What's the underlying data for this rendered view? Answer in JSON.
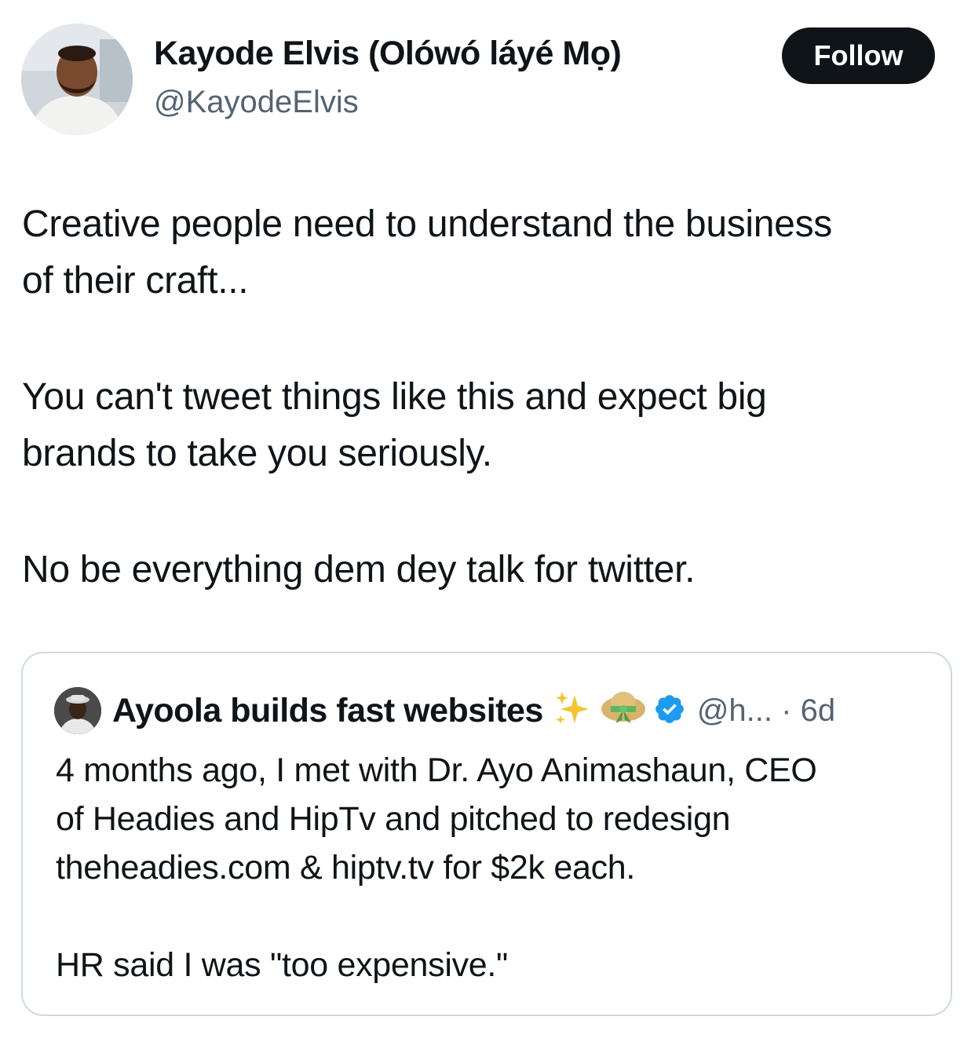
{
  "tweet": {
    "author": {
      "name": "Kayode Elvis (Olówó láyé Mọ)",
      "handle": "@KayodeElvis"
    },
    "follow_label": "Follow",
    "text": {
      "p1_line1": "Creative people need to understand the business",
      "p1_line2": "of their craft...",
      "p2_line1": "You can't tweet things like this and expect big",
      "p2_line2": "brands to take you seriously.",
      "p3_line1": "No be everything dem dey talk for twitter."
    }
  },
  "quoted_tweet": {
    "author": {
      "name": "Ayoola builds fast websites",
      "emoji_1": "sparkles-icon",
      "emoji_2": "straw-hat-icon",
      "verified": "verified-badge-icon"
    },
    "handle_time": "@h... · 6d",
    "text": {
      "p1_line1": "4 months ago, I met with Dr. Ayo Animashaun, CEO",
      "p1_line2": "of Headies and HipTv and pitched to redesign",
      "p1_line3": "theheadies.com & hiptv.tv for $2k each.",
      "p2_line1": "HR said I was \"too expensive.\""
    }
  },
  "colors": {
    "text_primary": "#0f1419",
    "text_secondary": "#536471",
    "follow_button_bg": "#0f1419",
    "verified_blue": "#1d9bf0",
    "card_border": "#cfd9de"
  }
}
